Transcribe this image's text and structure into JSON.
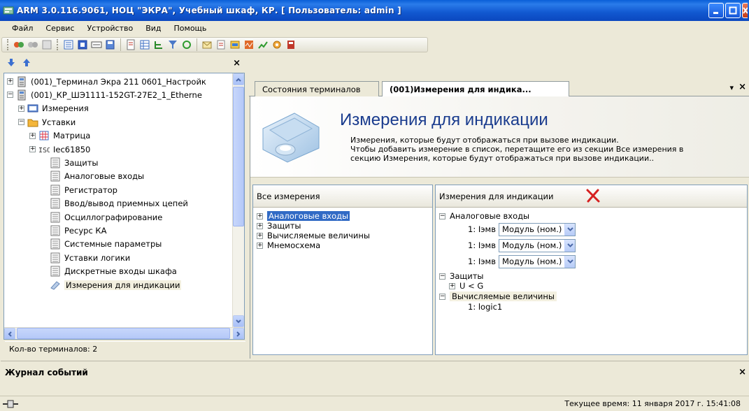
{
  "window": {
    "title": "ARM 3.0.116.9061, НОЦ \"ЭКРА\", Учебный шкаф, КР. [ Пользователь: admin ]"
  },
  "menu": [
    "Файл",
    "Сервис",
    "Устройство",
    "Вид",
    "Помощь"
  ],
  "left_panel": {
    "close_label": "×",
    "tree": [
      {
        "label": "(001)_Терминал Экра 211 0601_Настройк",
        "expander": "+",
        "icon": "device-icon"
      },
      {
        "label": "(001)_КР_ШЭ1111-152GT-27E2_1_Etherne",
        "expander": "−",
        "icon": "device-icon"
      },
      {
        "label": "Измерения",
        "expander": "+",
        "icon": "measurements-icon"
      },
      {
        "label": "Уставки",
        "expander": "−",
        "icon": "folder-icon"
      },
      {
        "label": "Матрица",
        "expander": "+",
        "icon": "matrix-icon"
      },
      {
        "label": "Iec61850",
        "expander": "+",
        "icon": "iec-icon"
      },
      {
        "label": "Защиты",
        "icon": "sheet-icon"
      },
      {
        "label": "Аналоговые входы",
        "icon": "sheet-icon"
      },
      {
        "label": "Регистратор",
        "icon": "sheet-icon"
      },
      {
        "label": "Ввод/вывод приемных цепей",
        "icon": "sheet-icon"
      },
      {
        "label": "Осциллографирование",
        "icon": "sheet-icon"
      },
      {
        "label": "Ресурс КА",
        "icon": "sheet-icon"
      },
      {
        "label": "Системные параметры",
        "icon": "sheet-icon"
      },
      {
        "label": "Уставки логики",
        "icon": "sheet-icon"
      },
      {
        "label": "Дискретные входы шкафа",
        "icon": "sheet-icon"
      },
      {
        "label": "Измерения для индикации",
        "icon": "gauge-icon",
        "selected": true
      }
    ],
    "status": "Кол-во терминалов: 2"
  },
  "tabs": [
    {
      "label": "Состояния терминалов"
    },
    {
      "label": "(001)Измерения для индика...",
      "active": true
    }
  ],
  "tab_menu_glyph": "▾",
  "tab_close_glyph": "×",
  "banner": {
    "title": "Измерения для индикации",
    "desc_line1": "Измерения, которые будут отображаться при вызове индикации.",
    "desc_line2": "Чтобы добавить измерение в список, перетащите его из секции Все измерения в",
    "desc_line3": "секцию Измерения, которые будут отображаться при вызове индикации.."
  },
  "all_measurements": {
    "header": "Все измерения",
    "items": [
      "Аналоговые входы",
      "Защиты",
      "Вычисляемые величины",
      "Мнемосхема"
    ]
  },
  "indication": {
    "header": "Измерения для индикации",
    "group_analog": "Аналоговые входы",
    "analog_rows": [
      {
        "name": "1: Iэмв",
        "value": "Модуль (ном.)"
      },
      {
        "name": "1: Iэмв",
        "value": "Модуль (ном.)"
      },
      {
        "name": "1: Iэмв",
        "value": "Модуль (ном.)"
      }
    ],
    "group_protection": "Защиты",
    "protection_item": "U < G",
    "group_calc": "Вычисляемые величины",
    "calc_item": "1: logic1"
  },
  "events": {
    "title": "Журнал событий",
    "close_label": "×"
  },
  "statusbar": {
    "time": "Текущее время: 11 января 2017 г. 15:41:08"
  },
  "colors": {
    "titlebar": "#0b55d4",
    "selection": "#316ac5",
    "heading": "#1a3c8e",
    "delete_x": "#d62020"
  }
}
